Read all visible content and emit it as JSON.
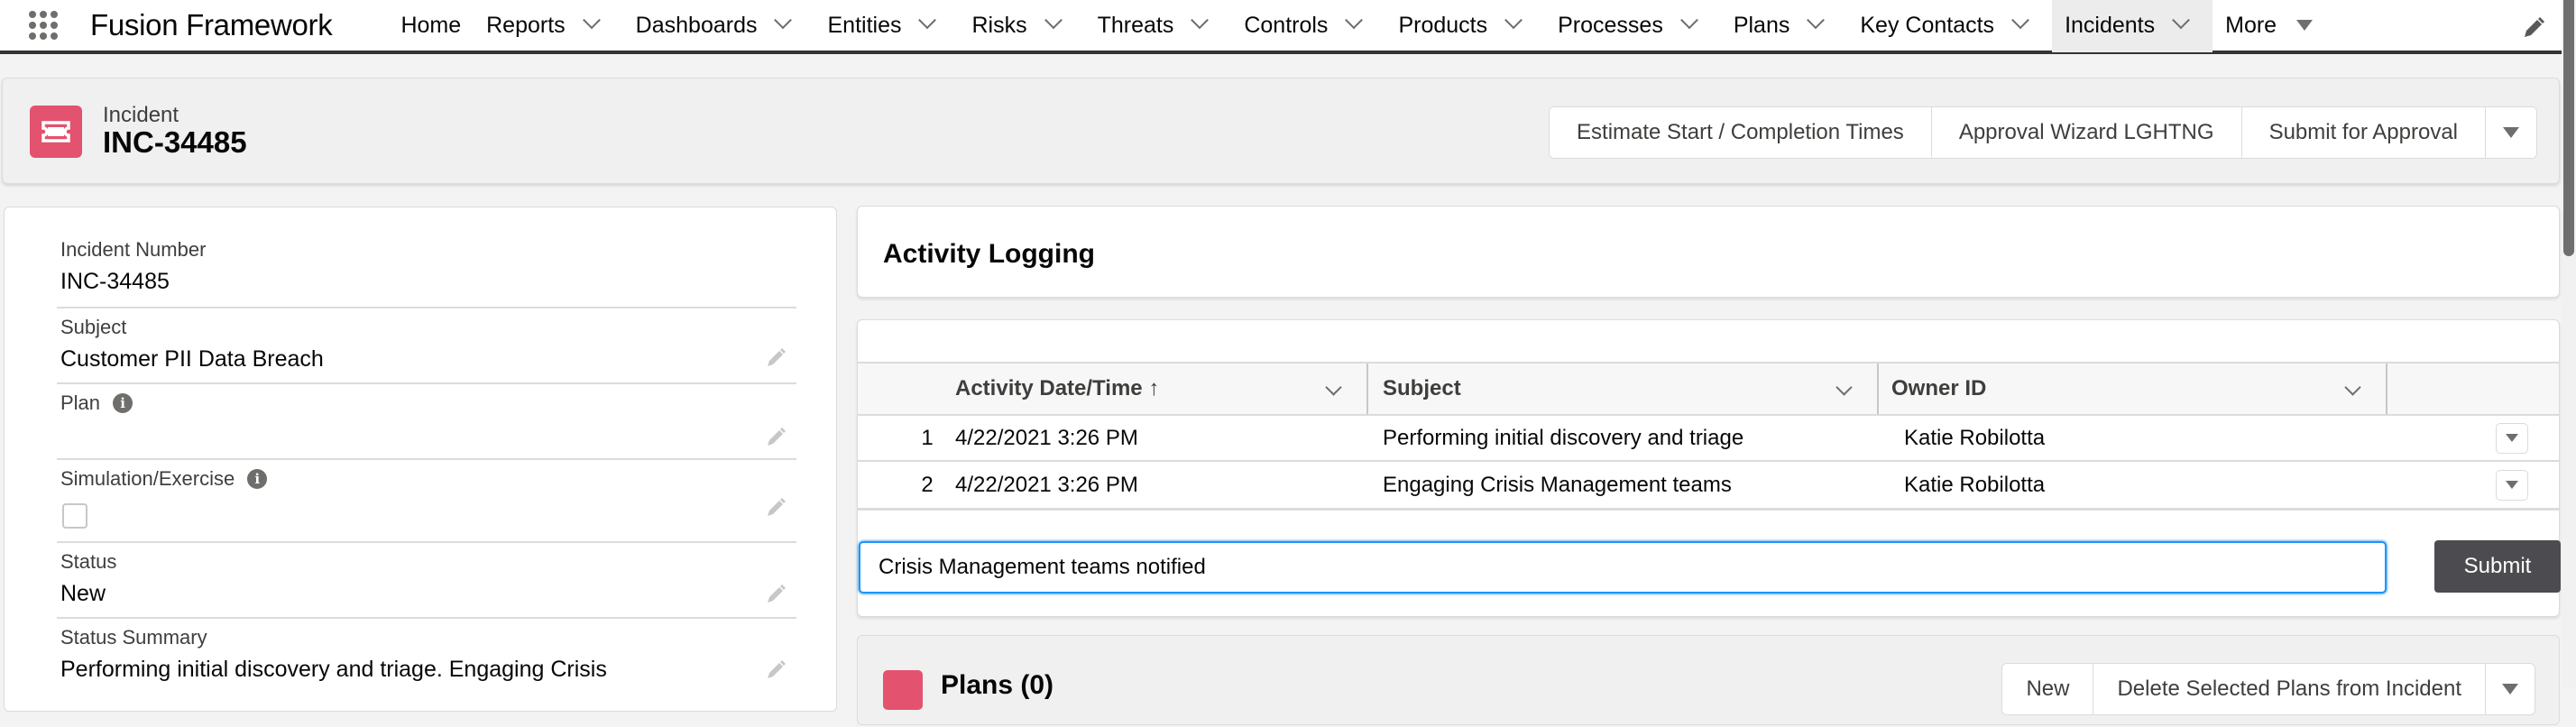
{
  "app": {
    "name": "Fusion Framework"
  },
  "nav": {
    "items": [
      {
        "label": "Home",
        "has_menu": false
      },
      {
        "label": "Reports",
        "has_menu": true
      },
      {
        "label": "Dashboards",
        "has_menu": true
      },
      {
        "label": "Entities",
        "has_menu": true
      },
      {
        "label": "Risks",
        "has_menu": true
      },
      {
        "label": "Threats",
        "has_menu": true
      },
      {
        "label": "Controls",
        "has_menu": true
      },
      {
        "label": "Products",
        "has_menu": true
      },
      {
        "label": "Processes",
        "has_menu": true
      },
      {
        "label": "Plans",
        "has_menu": true
      },
      {
        "label": "Key Contacts",
        "has_menu": true
      },
      {
        "label": "Incidents",
        "has_menu": true,
        "active": true
      },
      {
        "label": "More",
        "has_menu": true
      }
    ]
  },
  "record": {
    "type_label": "Incident",
    "title": "INC-34485",
    "icon": "ticket-icon",
    "icon_color": "#e3526f",
    "actions": [
      "Estimate Start / Completion Times",
      "Approval Wizard LGHTNG",
      "Submit for Approval"
    ]
  },
  "details": {
    "fields": [
      {
        "label": "Incident Number",
        "value": "INC-34485",
        "editable": false
      },
      {
        "label": "Subject",
        "value": "Customer PII Data Breach",
        "editable": true
      },
      {
        "label": "Plan",
        "value": "",
        "editable": true,
        "has_info": true
      },
      {
        "label": "Simulation/Exercise",
        "value": "",
        "type": "checkbox",
        "checked": false,
        "editable": true,
        "has_info": true
      },
      {
        "label": "Status",
        "value": "New",
        "editable": true
      },
      {
        "label": "Status Summary",
        "value": "Performing initial discovery and triage. Engaging Crisis",
        "editable": true
      }
    ]
  },
  "activity": {
    "title": "Activity Logging",
    "columns": [
      "Activity Date/Time",
      "Subject",
      "Owner ID"
    ],
    "sort_indicator": "↑",
    "rows": [
      {
        "num": "1",
        "date": "4/22/2021 3:26 PM",
        "subject": "Performing initial discovery and triage",
        "owner": "Katie Robilotta"
      },
      {
        "num": "2",
        "date": "4/22/2021 3:26 PM",
        "subject": "Engaging Crisis Management teams",
        "owner": "Katie Robilotta"
      }
    ],
    "input_value": "Crisis Management teams notified",
    "submit_label": "Submit",
    "input_focus_color": "#1b96ff"
  },
  "plans": {
    "title": "Plans (0)",
    "actions": [
      "New",
      "Delete Selected Plans from Incident"
    ]
  }
}
